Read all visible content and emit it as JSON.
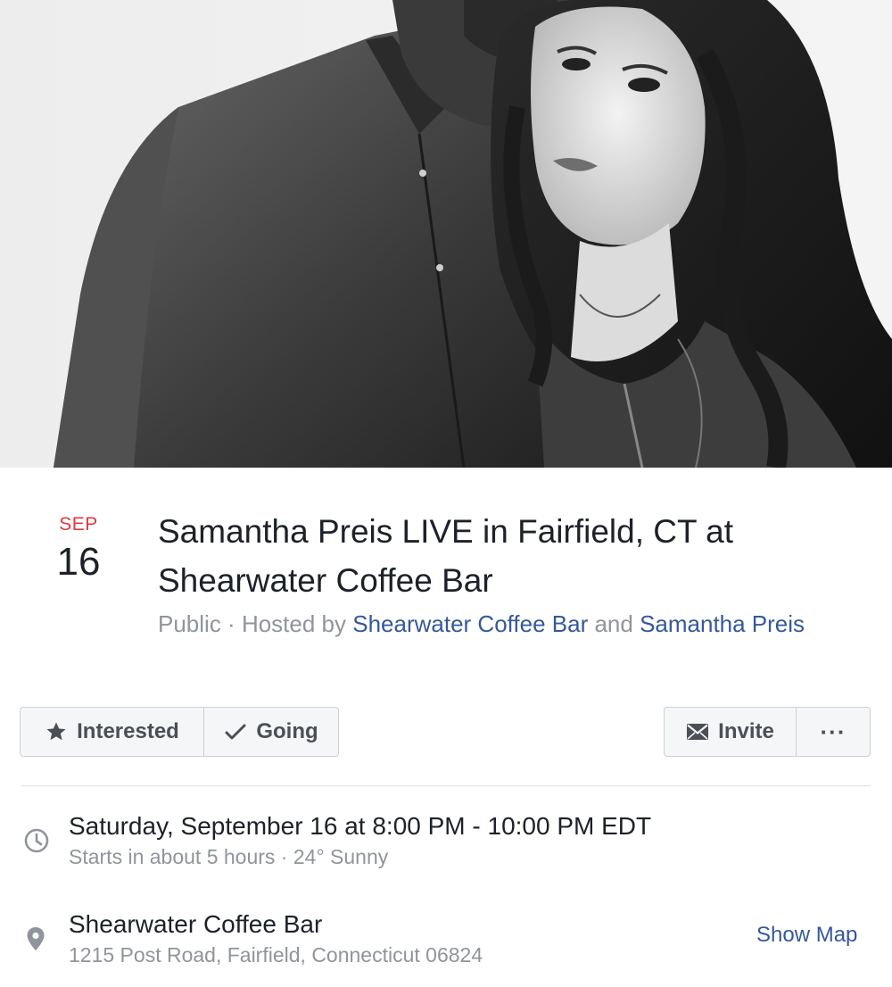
{
  "event": {
    "date": {
      "month": "SEP",
      "day": "16"
    },
    "title": "Samantha Preis LIVE in Fairfield, CT at Shearwater Coffee Bar",
    "meta": {
      "privacy": "Public",
      "separator": " · ",
      "hosted_by_prefix": "Hosted by ",
      "host_1": "Shearwater Coffee Bar",
      "conjunction": " and ",
      "host_2": "Samantha Preis"
    }
  },
  "actions": {
    "interested_label": "Interested",
    "going_label": "Going",
    "invite_label": "Invite",
    "more_label": "···"
  },
  "time": {
    "main": "Saturday, September 16 at 8:00 PM - 10:00 PM EDT",
    "sub": "Starts in about 5 hours · 24° Sunny"
  },
  "location": {
    "name": "Shearwater Coffee Bar",
    "address": "1215 Post Road, Fairfield, Connecticut 06824",
    "show_map_label": "Show Map"
  },
  "icons": {
    "interested": "star-icon",
    "going": "checkmark-icon",
    "invite": "envelope-icon",
    "more": "ellipsis-icon",
    "time": "clock-icon",
    "location": "map-pin-icon"
  },
  "colors": {
    "date_month": "#e0393e",
    "link": "#365899",
    "secondary_text": "#90949c",
    "primary_text": "#1d2129",
    "button_bg": "#f5f6f7",
    "button_border": "#ccd0d5"
  }
}
